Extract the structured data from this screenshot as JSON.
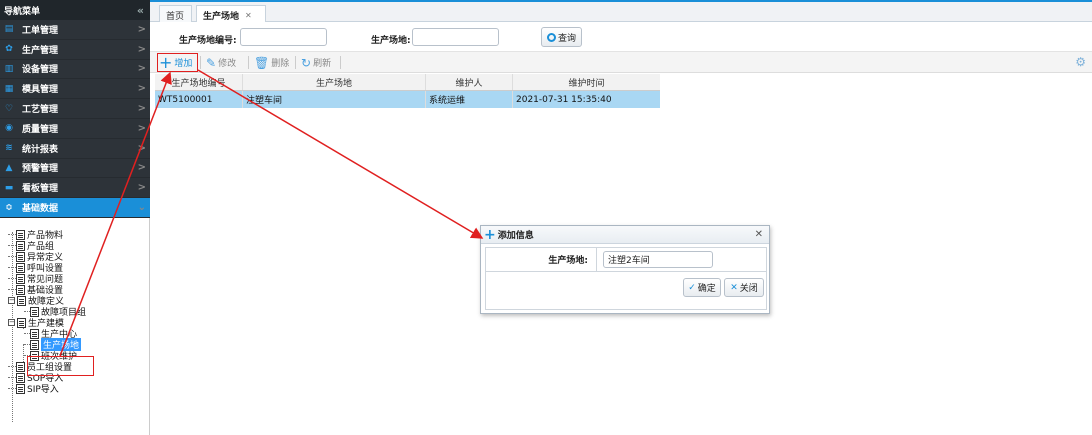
{
  "sidebar": {
    "header": "导航菜单",
    "collapse_icon": "«",
    "items": [
      {
        "label": "工单管理",
        "icon": "▤"
      },
      {
        "label": "生产管理",
        "icon": "✿"
      },
      {
        "label": "设备管理",
        "icon": "▥"
      },
      {
        "label": "模具管理",
        "icon": "▦"
      },
      {
        "label": "工艺管理",
        "icon": "♡"
      },
      {
        "label": "质量管理",
        "icon": "◉"
      },
      {
        "label": "统计报表",
        "icon": "≋"
      },
      {
        "label": "预警管理",
        "icon": "▲"
      },
      {
        "label": "看板管理",
        "icon": "▬"
      },
      {
        "label": "基础数据",
        "icon": "≎"
      }
    ],
    "tree": [
      "产品物料",
      "产品组",
      "异常定义",
      "呼叫设置",
      "常见问题",
      "基础设置",
      "故障定义",
      "故障项目组",
      "生产建模",
      "生产中心",
      "生产场地",
      "班次维护",
      "员工组设置",
      "SOP导入",
      "SIP导入"
    ]
  },
  "tabs": {
    "home": "首页",
    "current": "生产场地"
  },
  "search": {
    "code_label": "生产场地编号:",
    "code_value": "",
    "site_label": "生产场地:",
    "site_value": "",
    "query_button": "查询"
  },
  "toolbar": {
    "add": "增加",
    "edit": "修改",
    "delete": "删除",
    "refresh": "刷新"
  },
  "grid": {
    "headers": [
      "生产场地编号",
      "生产场地",
      "维护人",
      "维护时间"
    ],
    "rows": [
      [
        "WT5100001",
        "注塑车间",
        "系统运维",
        "2021-07-31 15:35:40"
      ]
    ]
  },
  "dialog": {
    "title": "添加信息",
    "field_label": "生产场地:",
    "field_value": "注塑2车间",
    "ok_button": "确定",
    "cancel_button": "关闭"
  },
  "colors": {
    "accent": "#1a8fd8",
    "annotation": "#e02020",
    "selected_row": "#a9d7f3",
    "sidebar_bg": "#2d3339"
  }
}
